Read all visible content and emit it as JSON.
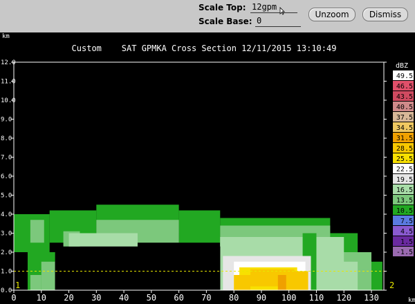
{
  "toolbar": {
    "scale_top_label": "Scale Top:",
    "scale_top_value": "12gpm",
    "scale_base_label": "Scale Base:",
    "scale_base_value": "0",
    "unzoom_label": "Unzoom",
    "dismiss_label": "Dismiss"
  },
  "chart_data": {
    "type": "heatmap",
    "title": "Custom    SAT GPMKA Cross Section 12/11/2015 13:10:49",
    "ylabel": "km",
    "xlabel": "km",
    "xlim": [
      0,
      140
    ],
    "ylim": [
      0,
      12
    ],
    "x_ticks": [
      0,
      10,
      20,
      30,
      40,
      50,
      60,
      70,
      80,
      90,
      100,
      110,
      120,
      130
    ],
    "x_tick_labels": [
      "0",
      "10",
      "20",
      "30",
      "40",
      "50",
      "60",
      "70",
      "80",
      "90",
      "100",
      "110",
      "120",
      "130"
    ],
    "y_ticks": [
      0,
      1,
      2,
      3,
      4,
      5,
      6,
      7,
      8,
      9,
      10,
      11,
      12
    ],
    "y_tick_labels": [
      "0.0",
      "1.0",
      "2.0",
      "3.0",
      "4.0",
      "5.0",
      "6.0",
      "7.0",
      "8.0",
      "9.0",
      "10.0",
      "11.0",
      "12.0"
    ],
    "endpoint_labels": [
      "1",
      "2"
    ],
    "reference_line_y": 1.0,
    "legend": {
      "title": "dBZ",
      "placement": "right",
      "entries": [
        {
          "label": "49.5",
          "color": "#ffffff"
        },
        {
          "label": "46.5",
          "color": "#e0506a"
        },
        {
          "label": "43.5",
          "color": "#d04a60"
        },
        {
          "label": "40.5",
          "color": "#cf8a8a"
        },
        {
          "label": "37.5",
          "color": "#d8b898"
        },
        {
          "label": "34.5",
          "color": "#f0c860"
        },
        {
          "label": "31.5",
          "color": "#f0a000"
        },
        {
          "label": "28.5",
          "color": "#f8c800"
        },
        {
          "label": "25.5",
          "color": "#f8e000"
        },
        {
          "label": "22.5",
          "color": "#ffffff"
        },
        {
          "label": "19.5",
          "color": "#e6e6e6"
        },
        {
          "label": "16.5",
          "color": "#a8dca8"
        },
        {
          "label": "13.5",
          "color": "#7cc87c"
        },
        {
          "label": "10.5",
          "color": "#22a822"
        },
        {
          "label": "7.5",
          "color": "#5a7ae0"
        },
        {
          "label": "4.5",
          "color": "#8a5ad0"
        },
        {
          "label": "1.5",
          "color": "#6a2aa0"
        },
        {
          "label": "-1.5",
          "color": "#9a6ab0"
        }
      ]
    },
    "cells": [
      {
        "x0": 0,
        "x1": 13,
        "y0": 2.0,
        "y1": 4.0,
        "c": "#22a822"
      },
      {
        "x0": 13,
        "x1": 30,
        "y0": 2.5,
        "y1": 4.2,
        "c": "#22a822"
      },
      {
        "x0": 30,
        "x1": 60,
        "y0": 3.0,
        "y1": 4.5,
        "c": "#22a822"
      },
      {
        "x0": 60,
        "x1": 75,
        "y0": 2.5,
        "y1": 4.2,
        "c": "#22a822"
      },
      {
        "x0": 75,
        "x1": 115,
        "y0": 1.0,
        "y1": 3.8,
        "c": "#22a822"
      },
      {
        "x0": 115,
        "x1": 125,
        "y0": 1.0,
        "y1": 3.0,
        "c": "#22a822"
      },
      {
        "x0": 125,
        "x1": 134,
        "y0": 0.0,
        "y1": 1.5,
        "c": "#22a822"
      },
      {
        "x0": 6,
        "x1": 11,
        "y0": 2.5,
        "y1": 3.7,
        "c": "#7cc87c"
      },
      {
        "x0": 18,
        "x1": 24,
        "y0": 2.3,
        "y1": 3.1,
        "c": "#7cc87c"
      },
      {
        "x0": 30,
        "x1": 60,
        "y0": 2.5,
        "y1": 3.7,
        "c": "#7cc87c"
      },
      {
        "x0": 75,
        "x1": 115,
        "y0": 1.0,
        "y1": 3.4,
        "c": "#7cc87c"
      },
      {
        "x0": 115,
        "x1": 130,
        "y0": 0.0,
        "y1": 2.0,
        "c": "#7cc87c"
      },
      {
        "x0": 20,
        "x1": 45,
        "y0": 2.3,
        "y1": 3.0,
        "c": "#a8dca8"
      },
      {
        "x0": 75,
        "x1": 120,
        "y0": 0.0,
        "y1": 2.8,
        "c": "#a8dca8"
      },
      {
        "x0": 110,
        "x1": 125,
        "y0": 0.0,
        "y1": 1.5,
        "c": "#a8dca8"
      },
      {
        "x0": 5,
        "x1": 15,
        "y0": 0.0,
        "y1": 2.0,
        "c": "#22a822"
      },
      {
        "x0": 10,
        "x1": 15,
        "y0": 0.0,
        "y1": 1.5,
        "c": "#7cc87c"
      },
      {
        "x0": 6,
        "x1": 10,
        "y0": 0.0,
        "y1": 0.8,
        "c": "#7cc87c"
      },
      {
        "x0": 58,
        "x1": 62,
        "y0": 0.0,
        "y1": 0.9,
        "c": "#22a822"
      },
      {
        "x0": 105,
        "x1": 110,
        "y0": 0.0,
        "y1": 3.0,
        "c": "#22a822"
      },
      {
        "x0": 76,
        "x1": 108,
        "y0": 0.0,
        "y1": 1.8,
        "c": "#e6e6e6"
      },
      {
        "x0": 80,
        "x1": 106,
        "y0": 0.0,
        "y1": 1.5,
        "c": "#ffffff"
      },
      {
        "x0": 82,
        "x1": 103,
        "y0": 0.0,
        "y1": 1.2,
        "c": "#f8e000"
      },
      {
        "x0": 86,
        "x1": 102,
        "y0": 0.2,
        "y1": 1.1,
        "c": "#f8c800"
      },
      {
        "x0": 80,
        "x1": 86,
        "y0": 0.0,
        "y1": 0.8,
        "c": "#f8c800"
      },
      {
        "x0": 96,
        "x1": 101,
        "y0": 0.0,
        "y1": 0.8,
        "c": "#f0a000"
      },
      {
        "x0": 99,
        "x1": 107,
        "y0": 0.0,
        "y1": 1.0,
        "c": "#f8c800"
      }
    ],
    "gaps": [
      {
        "x0": 15,
        "x1": 45,
        "y0": 0.0,
        "y1": 1.5
      },
      {
        "x0": 45,
        "x1": 58,
        "y0": 0.0,
        "y1": 2.0
      },
      {
        "x0": 62,
        "x1": 75,
        "y0": 0.0,
        "y1": 2.3
      },
      {
        "x0": 0,
        "x1": 5,
        "y0": 0.0,
        "y1": 2.0
      },
      {
        "x0": 134,
        "x1": 140,
        "y0": 0.0,
        "y1": 2.0
      },
      {
        "x0": 52,
        "x1": 75,
        "y0": 0.0,
        "y1": 2.3
      }
    ]
  }
}
